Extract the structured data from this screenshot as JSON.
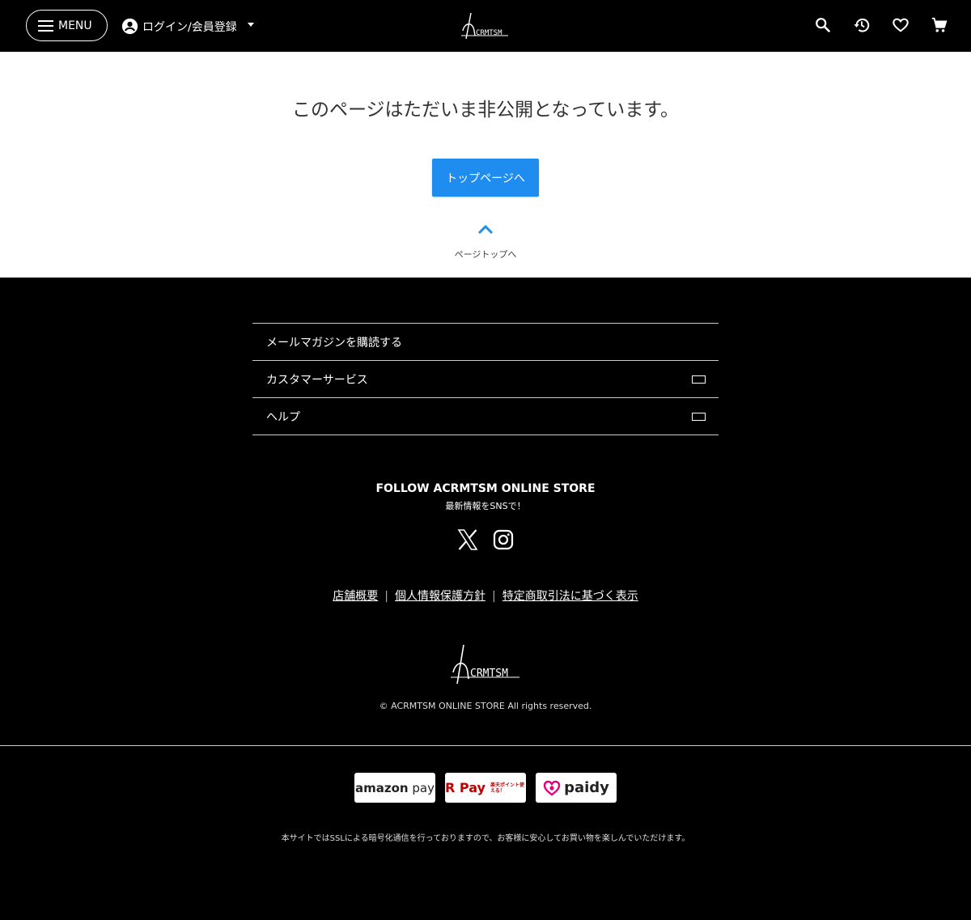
{
  "header": {
    "menu_label": "MENU",
    "login_label": "ログイン/会員登録",
    "icons": [
      "search-icon",
      "history-icon",
      "heart-icon",
      "cart-icon"
    ]
  },
  "main": {
    "notice": "このページはただいま非公開となっています。",
    "top_button": "トップページへ",
    "pagetop_label": "ページトップへ"
  },
  "footer": {
    "list": [
      {
        "label": "メールマガジンを購読する",
        "expand": false
      },
      {
        "label": "カスタマーサービス",
        "expand": true
      },
      {
        "label": "ヘルプ",
        "expand": true
      }
    ],
    "follow_title": "FOLLOW ACRMTSM ONLINE STORE",
    "follow_sub": "最新情報をSNSで！",
    "sns": [
      "x-icon",
      "instagram-icon"
    ],
    "links": [
      "店舗概要",
      "個人情報保護方針",
      "特定商取引法に基づく表示"
    ],
    "link_separator": "|",
    "copyright": "© ACRMTSM ONLINE STORE All rights reserved.",
    "logo_text": "ACRMTSM"
  },
  "payment": {
    "amazon": {
      "word1": "amazon",
      "word2": "pay"
    },
    "rakuten": {
      "r": "R",
      "pay": "Pay",
      "note": "楽天ポイント使える！"
    },
    "paidy": "paidy",
    "ssl_note": "本サイトではSSLによる暗号化通信を行っておりますので、お客様に安心してお買い物を楽しんでいただけます。"
  },
  "colors": {
    "accent": "#1f8cf0",
    "background": "#000000",
    "main_bg": "#ffffff",
    "paidy_pink": "#e5007f",
    "rakuten_red": "#bf0000"
  }
}
